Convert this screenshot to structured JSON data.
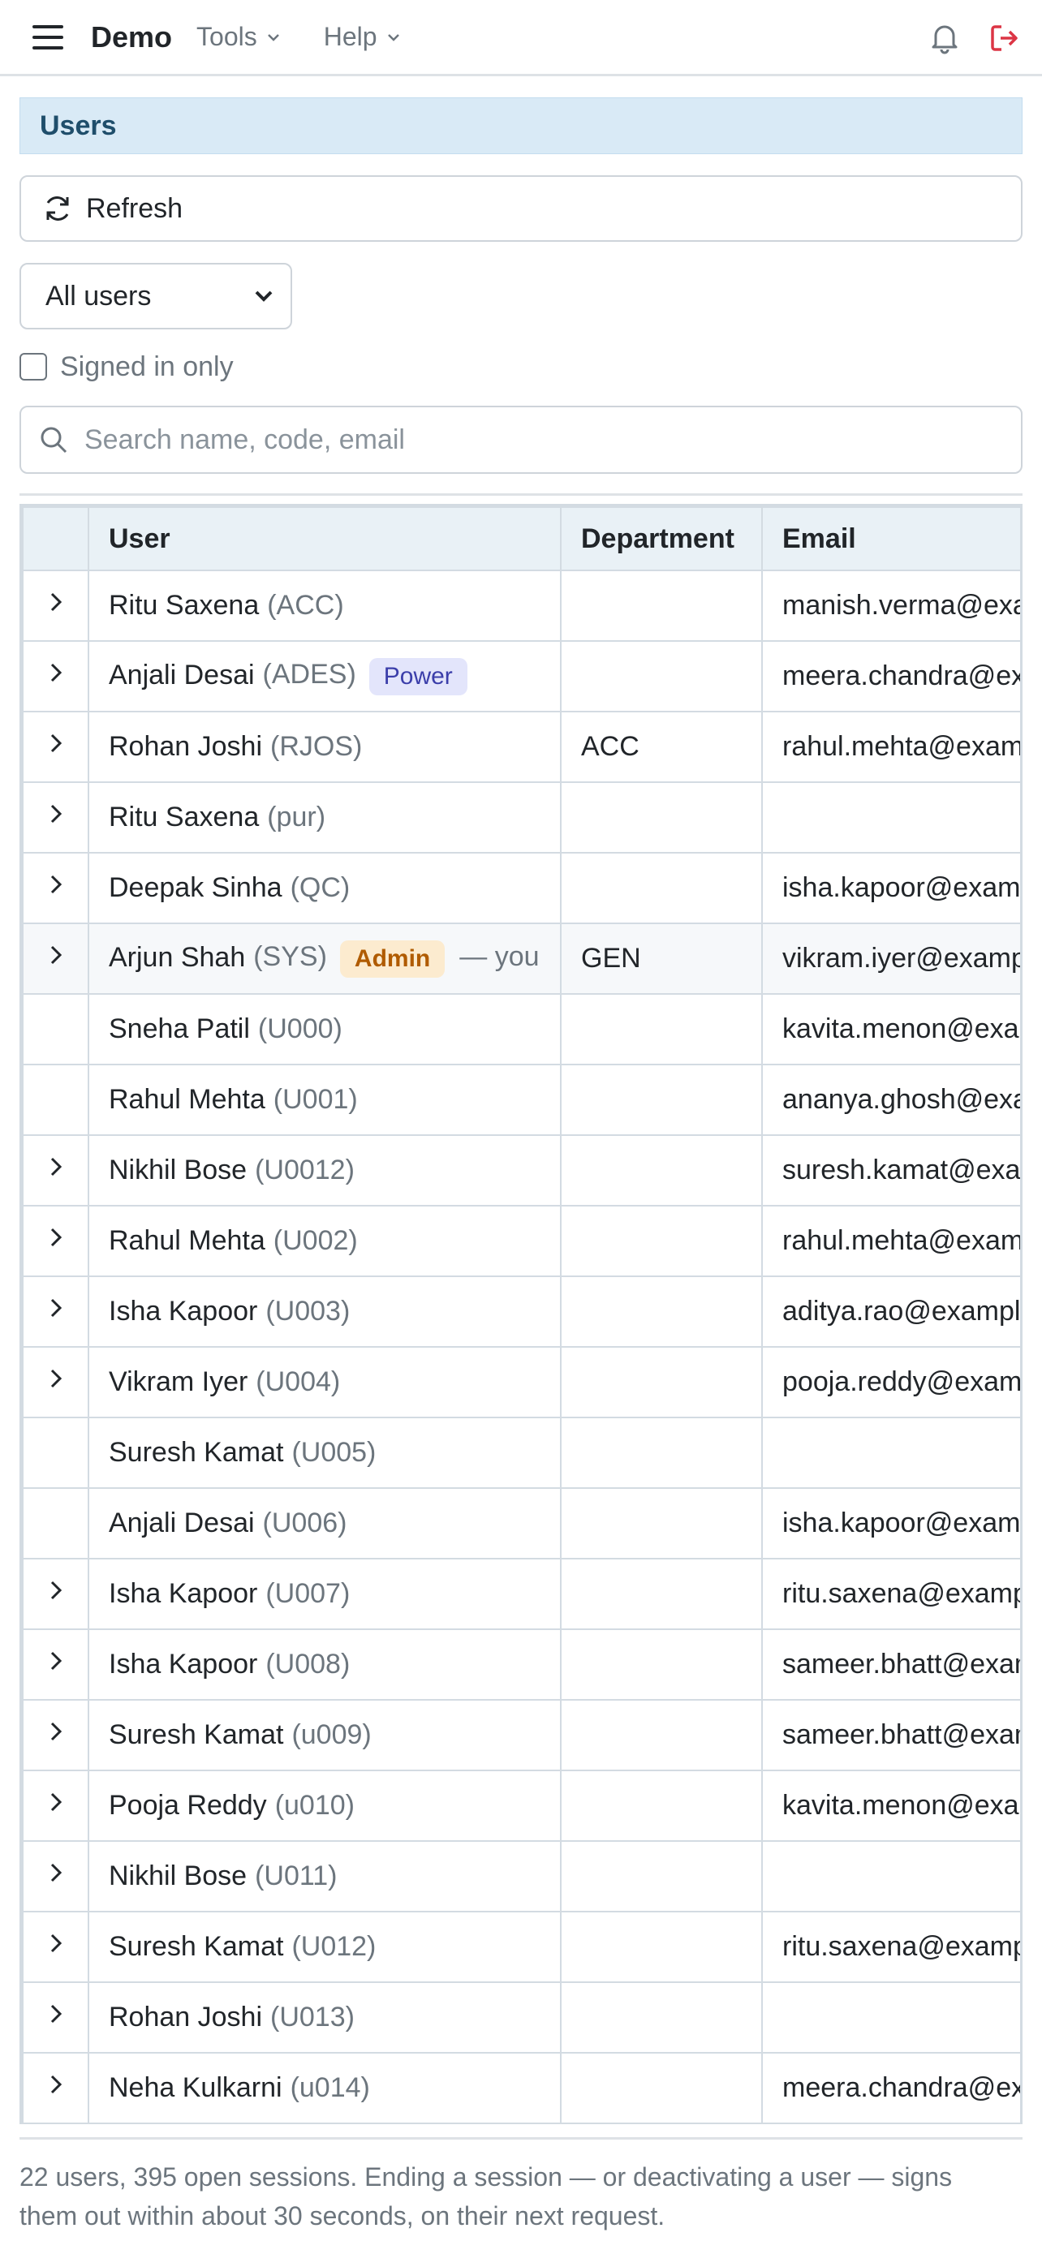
{
  "nav": {
    "brand": "Demo",
    "tools_label": "Tools",
    "help_label": "Help",
    "icons": [
      "hamburger-icon",
      "chevron-down-icon",
      "bell-icon",
      "logout-icon"
    ],
    "logout_color": "#dc3545"
  },
  "section": {
    "title": "Users"
  },
  "controls": {
    "refresh_label": "Refresh",
    "filter_selected": "All users",
    "signed_in_label": "Signed in only",
    "signed_in_checked": false,
    "search_placeholder": "Search name, code, email",
    "search_value": ""
  },
  "table": {
    "columns": [
      "",
      "User",
      "Department",
      "Email"
    ],
    "rows": [
      {
        "expand": true,
        "name": "Ritu Saxena",
        "code": "(ACC)",
        "badge": "",
        "you": "",
        "dept": "",
        "email": "manish.verma@example.com"
      },
      {
        "expand": true,
        "name": "Anjali Desai",
        "code": "(ADES)",
        "badge": "Power",
        "you": "",
        "dept": "",
        "email": "meera.chandra@example.com"
      },
      {
        "expand": true,
        "name": "Rohan Joshi",
        "code": "(RJOS)",
        "badge": "",
        "you": "",
        "dept": "ACC",
        "email": "rahul.mehta@example.com"
      },
      {
        "expand": true,
        "name": "Ritu Saxena",
        "code": "(pur)",
        "badge": "",
        "you": "",
        "dept": "",
        "email": ""
      },
      {
        "expand": true,
        "name": "Deepak Sinha",
        "code": "(QC)",
        "badge": "",
        "you": "",
        "dept": "",
        "email": "isha.kapoor@example.com"
      },
      {
        "expand": true,
        "name": "Arjun Shah",
        "code": "(SYS)",
        "badge": "Admin",
        "you": "— you",
        "dept": "GEN",
        "email": "vikram.iyer@example.com"
      },
      {
        "expand": false,
        "name": "Sneha Patil",
        "code": "(U000)",
        "badge": "",
        "you": "",
        "dept": "",
        "email": "kavita.menon@example.com"
      },
      {
        "expand": false,
        "name": "Rahul Mehta",
        "code": "(U001)",
        "badge": "",
        "you": "",
        "dept": "",
        "email": "ananya.ghosh@example.com"
      },
      {
        "expand": true,
        "name": "Nikhil Bose",
        "code": "(U0012)",
        "badge": "",
        "you": "",
        "dept": "",
        "email": "suresh.kamat@example.com"
      },
      {
        "expand": true,
        "name": "Rahul Mehta",
        "code": "(U002)",
        "badge": "",
        "you": "",
        "dept": "",
        "email": "rahul.mehta@example.com"
      },
      {
        "expand": true,
        "name": "Isha Kapoor",
        "code": "(U003)",
        "badge": "",
        "you": "",
        "dept": "",
        "email": "aditya.rao@example.com"
      },
      {
        "expand": true,
        "name": "Vikram Iyer",
        "code": "(U004)",
        "badge": "",
        "you": "",
        "dept": "",
        "email": "pooja.reddy@example.com"
      },
      {
        "expand": false,
        "name": "Suresh Kamat",
        "code": "(U005)",
        "badge": "",
        "you": "",
        "dept": "",
        "email": ""
      },
      {
        "expand": false,
        "name": "Anjali Desai",
        "code": "(U006)",
        "badge": "",
        "you": "",
        "dept": "",
        "email": "isha.kapoor@example.com"
      },
      {
        "expand": true,
        "name": "Isha Kapoor",
        "code": "(U007)",
        "badge": "",
        "you": "",
        "dept": "",
        "email": "ritu.saxena@example.com"
      },
      {
        "expand": true,
        "name": "Isha Kapoor",
        "code": "(U008)",
        "badge": "",
        "you": "",
        "dept": "",
        "email": "sameer.bhatt@example.com"
      },
      {
        "expand": true,
        "name": "Suresh Kamat",
        "code": "(u009)",
        "badge": "",
        "you": "",
        "dept": "",
        "email": "sameer.bhatt@example.com"
      },
      {
        "expand": true,
        "name": "Pooja Reddy",
        "code": "(u010)",
        "badge": "",
        "you": "",
        "dept": "",
        "email": "kavita.menon@example.com"
      },
      {
        "expand": true,
        "name": "Nikhil Bose",
        "code": "(U011)",
        "badge": "",
        "you": "",
        "dept": "",
        "email": ""
      },
      {
        "expand": true,
        "name": "Suresh Kamat",
        "code": "(U012)",
        "badge": "",
        "you": "",
        "dept": "",
        "email": "ritu.saxena@example.com"
      },
      {
        "expand": true,
        "name": "Rohan Joshi",
        "code": "(U013)",
        "badge": "",
        "you": "",
        "dept": "",
        "email": ""
      },
      {
        "expand": true,
        "name": "Neha Kulkarni",
        "code": "(u014)",
        "badge": "",
        "you": "",
        "dept": "",
        "email": "meera.chandra@example.com"
      }
    ]
  },
  "footer": {
    "text": "22 users, 395 open sessions. Ending a session — or deactivating a user — signs them out within about 30 seconds, on their next request."
  }
}
